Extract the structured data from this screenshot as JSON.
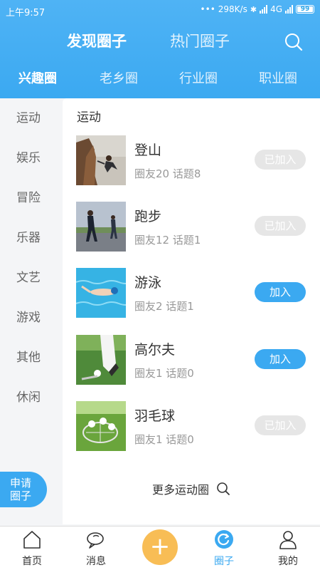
{
  "status": {
    "time": "上午9:57",
    "network_speed": "298K/s",
    "network_type": "4G",
    "battery": "99"
  },
  "header": {
    "tabs": [
      "发现圈子",
      "热门圈子"
    ],
    "active_tab": "发现圈子",
    "category_tabs": [
      "兴趣圈",
      "老乡圈",
      "行业圈",
      "职业圈"
    ],
    "active_category": "兴趣圈"
  },
  "sidebar": {
    "items": [
      "运动",
      "娱乐",
      "冒险",
      "乐器",
      "文艺",
      "游戏",
      "其他",
      "休闲"
    ],
    "apply_line1": "申请",
    "apply_line2": "圈子"
  },
  "panel": {
    "title": "运动",
    "circles": [
      {
        "name": "登山",
        "meta": "圈友20 话题8",
        "action": "已加入",
        "joined": true,
        "image": "mountain-climbing-photo"
      },
      {
        "name": "跑步",
        "meta": "圈友12 话题1",
        "action": "已加入",
        "joined": true,
        "image": "running-photo"
      },
      {
        "name": "游泳",
        "meta": "圈友2 话题1",
        "action": "加入",
        "joined": false,
        "image": "swimming-photo"
      },
      {
        "name": "高尔夫",
        "meta": "圈友1 话题0",
        "action": "加入",
        "joined": false,
        "image": "golf-photo"
      },
      {
        "name": "羽毛球",
        "meta": "圈友1 话题0",
        "action": "已加入",
        "joined": true,
        "image": "badminton-photo"
      }
    ],
    "more": "更多运动圈"
  },
  "bottom_nav": {
    "items": [
      {
        "label": "首页",
        "icon": "home-icon"
      },
      {
        "label": "消息",
        "icon": "chat-icon"
      },
      {
        "label": "",
        "icon": "plus-icon"
      },
      {
        "label": "圈子",
        "icon": "circle-icon"
      },
      {
        "label": "我的",
        "icon": "person-icon"
      }
    ],
    "active": "圈子"
  },
  "colors": {
    "accent": "#3ba9f1",
    "plus": "#f8bd55",
    "joined_bg": "#e6e6e6"
  }
}
